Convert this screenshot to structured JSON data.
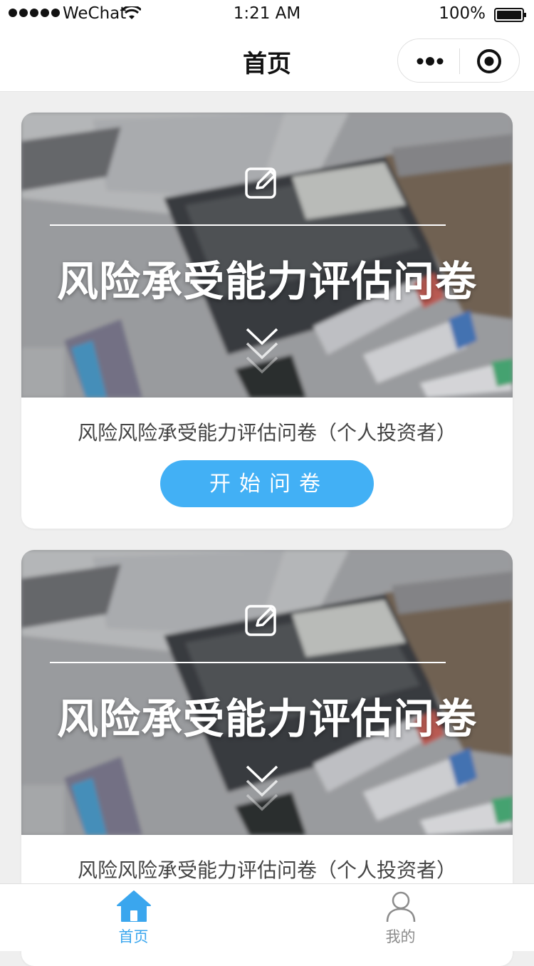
{
  "status_bar": {
    "carrier": "WeChat",
    "time": "1:21 AM",
    "battery": "100%"
  },
  "nav": {
    "title": "首页"
  },
  "cards": [
    {
      "banner_title": "风险承受能力评估问卷",
      "subtitle": "风险风险承受能力评估问卷（个人投资者）",
      "button_label": "开始问卷"
    },
    {
      "banner_title": "风险承受能力评估问卷",
      "subtitle": "风险风险承受能力评估问卷（个人投资者）"
    }
  ],
  "tab_bar": {
    "items": [
      {
        "label": "首页",
        "icon": "home-icon",
        "active": true
      },
      {
        "label": "我的",
        "icon": "user-icon",
        "active": false
      }
    ]
  },
  "colors": {
    "accent": "#42b0f5",
    "tab_active": "#3aa6ee",
    "tab_inactive": "#8c8c8c",
    "background": "#efefef"
  }
}
